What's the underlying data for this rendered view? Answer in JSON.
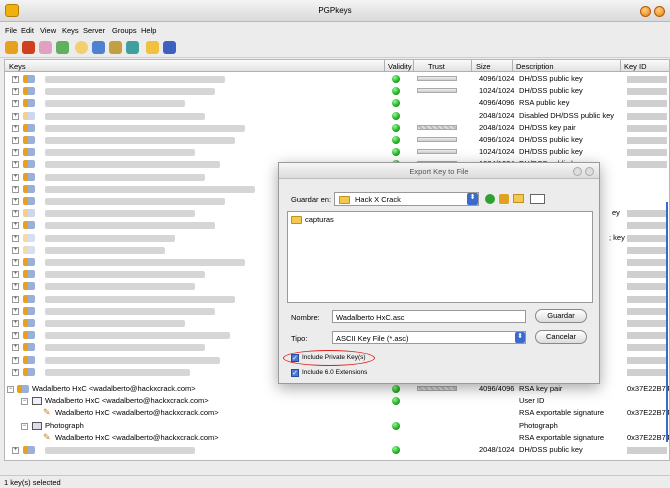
{
  "window": {
    "title": "PGPkeys"
  },
  "menu": [
    "File",
    "Edit",
    "View",
    "Keys",
    "Server",
    "Groups",
    "Help"
  ],
  "toolbar_icons": [
    "new-key-icon",
    "disable-icon",
    "sign-icon",
    "import-icon",
    "search-icon",
    "keyserver-icon",
    "properties-icon",
    "send-icon",
    "export-icon",
    "save-icon"
  ],
  "columns": {
    "keys": "Keys",
    "validity": "Validity",
    "trust": "Trust",
    "size": "Size",
    "description": "Description",
    "keyid": "Key ID"
  },
  "rows": [
    {
      "size": "4096/1024",
      "desc": "DH/DSS public key"
    },
    {
      "size": "1024/1024",
      "desc": "DH/DSS public key"
    },
    {
      "size": "4096/4096",
      "desc": "RSA public key"
    },
    {
      "size": "2048/1024",
      "desc": "Disabled DH/DSS public key"
    },
    {
      "size": "2048/1024",
      "desc": "DH/DSS key pair"
    },
    {
      "size": "4096/1024",
      "desc": "DH/DSS public key"
    },
    {
      "size": "1024/1024",
      "desc": "DH/DSS public key"
    },
    {
      "size": "1024/1024",
      "desc": "DH/DSS public key"
    }
  ],
  "partial_desc": {
    "row_a": "ey",
    "row_b": "; key"
  },
  "expanded_key": {
    "name": "Wadalberto HxC <wadalberto@hackxcrack.com>",
    "size": "4096/4096",
    "desc": "RSA key pair",
    "keyid": "0x37E22B74",
    "userid_name": "Wadalberto HxC <wadalberto@hackxcrack.com>",
    "userid_desc": "User ID",
    "sig1_name": "Wadalberto HxC <wadalberto@hackxcrack.com>",
    "sig1_desc": "RSA exportable signature",
    "sig1_keyid": "0x37E22B74",
    "photo_name": "Photograph",
    "photo_desc": "Photograph",
    "sig2_name": "Wadalberto HxC <wadalberto@hackxcrack.com>",
    "sig2_desc": "RSA exportable signature",
    "sig2_keyid": "0x37E22B74"
  },
  "last_row": {
    "size": "2048/1024",
    "desc": "DH/DSS public key"
  },
  "status": "1 key(s) selected",
  "dialog": {
    "title": "Export Key to File",
    "save_in_label": "Guardar en:",
    "save_in_value": "Hack X Crack",
    "folder_item": "capturas",
    "name_label": "Nombre:",
    "name_value": "Wadalberto HxC.asc",
    "save_button": "Guardar",
    "type_label": "Tipo:",
    "type_value": "ASCII Key File (*.asc)",
    "cancel_button": "Cancelar",
    "include_private": "Include Private Key(s)",
    "include_60": "Include 6.0 Extensions"
  }
}
